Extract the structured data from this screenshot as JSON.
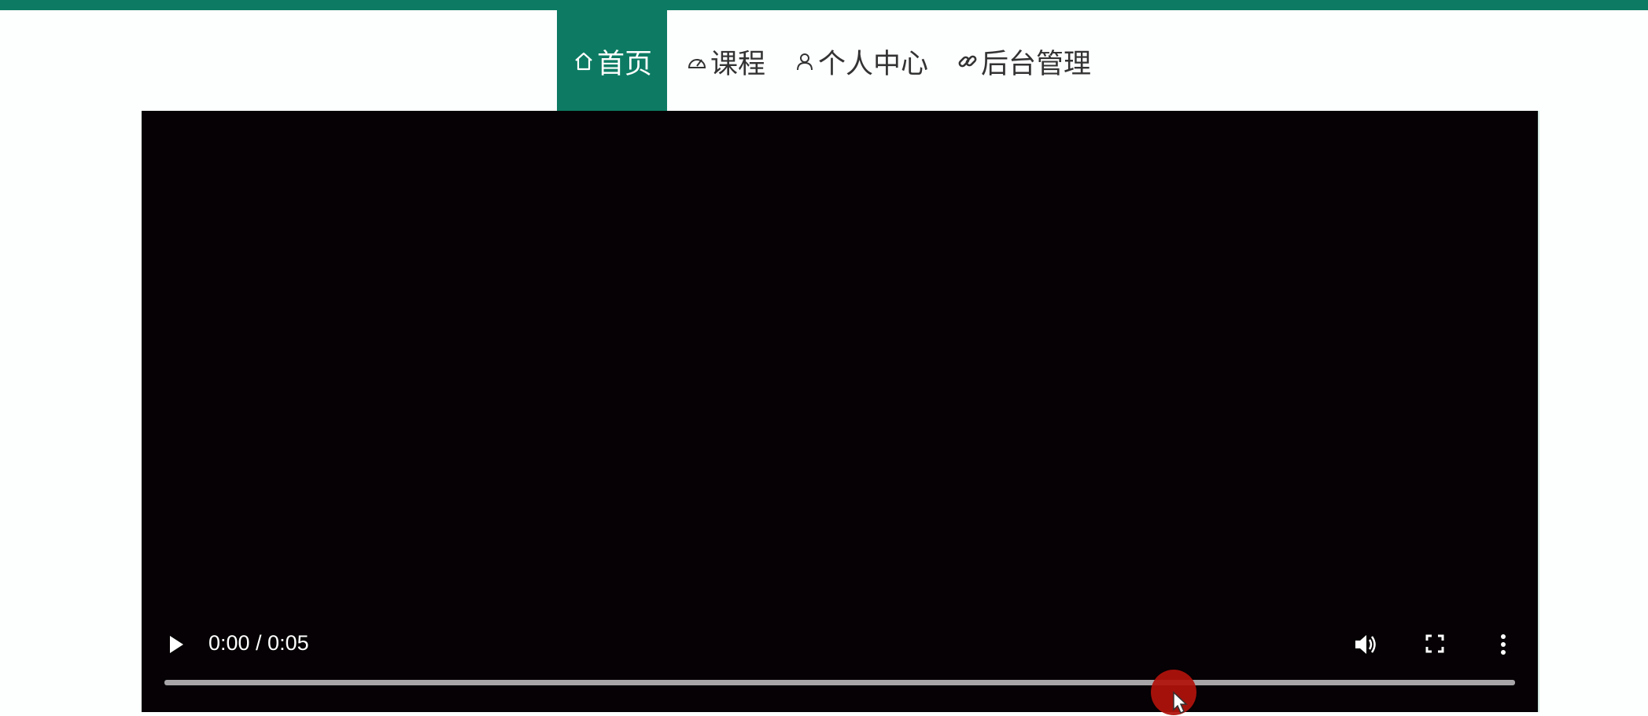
{
  "nav": {
    "items": [
      {
        "label": "首页",
        "icon": "home-icon",
        "active": true
      },
      {
        "label": "课程",
        "icon": "speedometer-icon",
        "active": false
      },
      {
        "label": "个人中心",
        "icon": "user-icon",
        "active": false
      },
      {
        "label": "后台管理",
        "icon": "link-icon",
        "active": false
      }
    ]
  },
  "video": {
    "time_display": "0:00 / 0:05",
    "progress": 0
  },
  "colors": {
    "accent": "#0d7b63",
    "video_bg": "#050104",
    "cursor_highlight": "#b0120c"
  }
}
